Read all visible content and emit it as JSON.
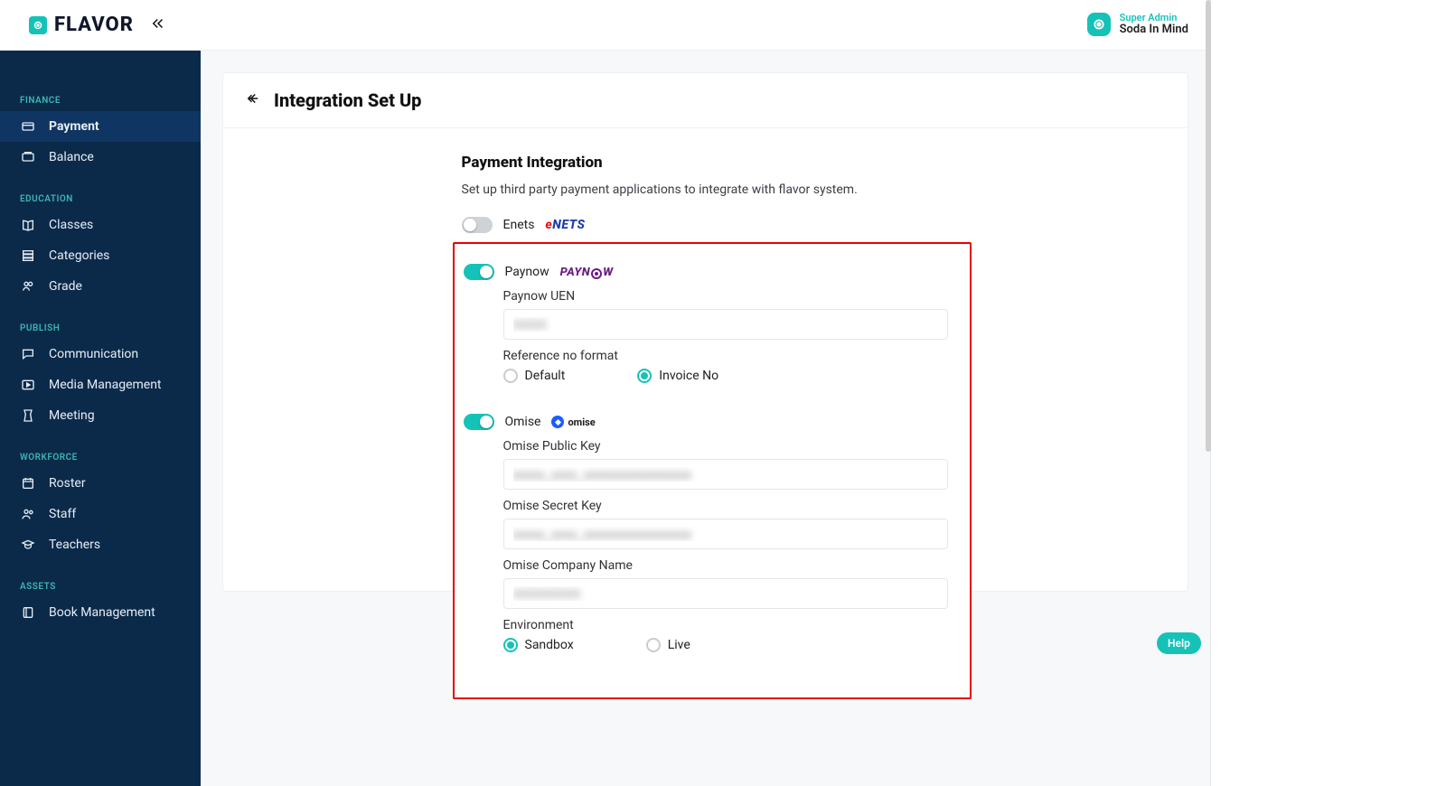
{
  "brand": {
    "name": "FLAVOR"
  },
  "user": {
    "role": "Super Admin",
    "name": "Soda In Mind"
  },
  "sidebar": {
    "sections": [
      {
        "heading": "FINANCE",
        "items": [
          {
            "icon": "card-icon",
            "label": "Payment",
            "active": true
          },
          {
            "icon": "wallet-icon",
            "label": "Balance",
            "active": false
          }
        ]
      },
      {
        "heading": "EDUCATION",
        "items": [
          {
            "icon": "book-icon",
            "label": "Classes",
            "active": false
          },
          {
            "icon": "stack-icon",
            "label": "Categories",
            "active": false
          },
          {
            "icon": "grade-icon",
            "label": "Grade",
            "active": false
          }
        ]
      },
      {
        "heading": "PUBLISH",
        "items": [
          {
            "icon": "chat-icon",
            "label": "Communication",
            "active": false
          },
          {
            "icon": "media-icon",
            "label": "Media Management",
            "active": false
          },
          {
            "icon": "meeting-icon",
            "label": "Meeting",
            "active": false
          }
        ]
      },
      {
        "heading": "WORKFORCE",
        "items": [
          {
            "icon": "calendar-icon",
            "label": "Roster",
            "active": false
          },
          {
            "icon": "people-icon",
            "label": "Staff",
            "active": false
          },
          {
            "icon": "cap-icon",
            "label": "Teachers",
            "active": false
          }
        ]
      },
      {
        "heading": "ASSETS",
        "items": [
          {
            "icon": "book2-icon",
            "label": "Book Management",
            "active": false
          }
        ]
      }
    ]
  },
  "page": {
    "title": "Integration Set Up",
    "section_title": "Payment Integration",
    "section_desc": "Set up third party payment applications to integrate with flavor system."
  },
  "integrations": {
    "enets": {
      "enabled": false,
      "label": "Enets",
      "badge_e": "e",
      "badge_nets": "NETS"
    },
    "paynow": {
      "enabled": true,
      "label": "Paynow",
      "badge_text_pre": "PAYN",
      "badge_text_post": "W",
      "uen_label": "Paynow UEN",
      "uen_value": "XXXX",
      "ref_label": "Reference no format",
      "ref_options": {
        "default": "Default",
        "invoice": "Invoice No"
      },
      "ref_selected": "invoice"
    },
    "omise": {
      "enabled": true,
      "label": "Omise",
      "badge_text": "omise",
      "public_key_label": "Omise Public Key",
      "public_key_value": "xxxxx_xxxx_xxxxxxxxxxxxxxxxx",
      "secret_key_label": "Omise Secret Key",
      "secret_key_value": "xxxxx_xxxx_xxxxxxxxxxxxxxxxx",
      "company_label": "Omise Company Name",
      "company_value": "XXXXXXXX",
      "env_label": "Environment",
      "env_options": {
        "sandbox": "Sandbox",
        "live": "Live"
      },
      "env_selected": "sandbox"
    }
  },
  "help_label": "Help"
}
